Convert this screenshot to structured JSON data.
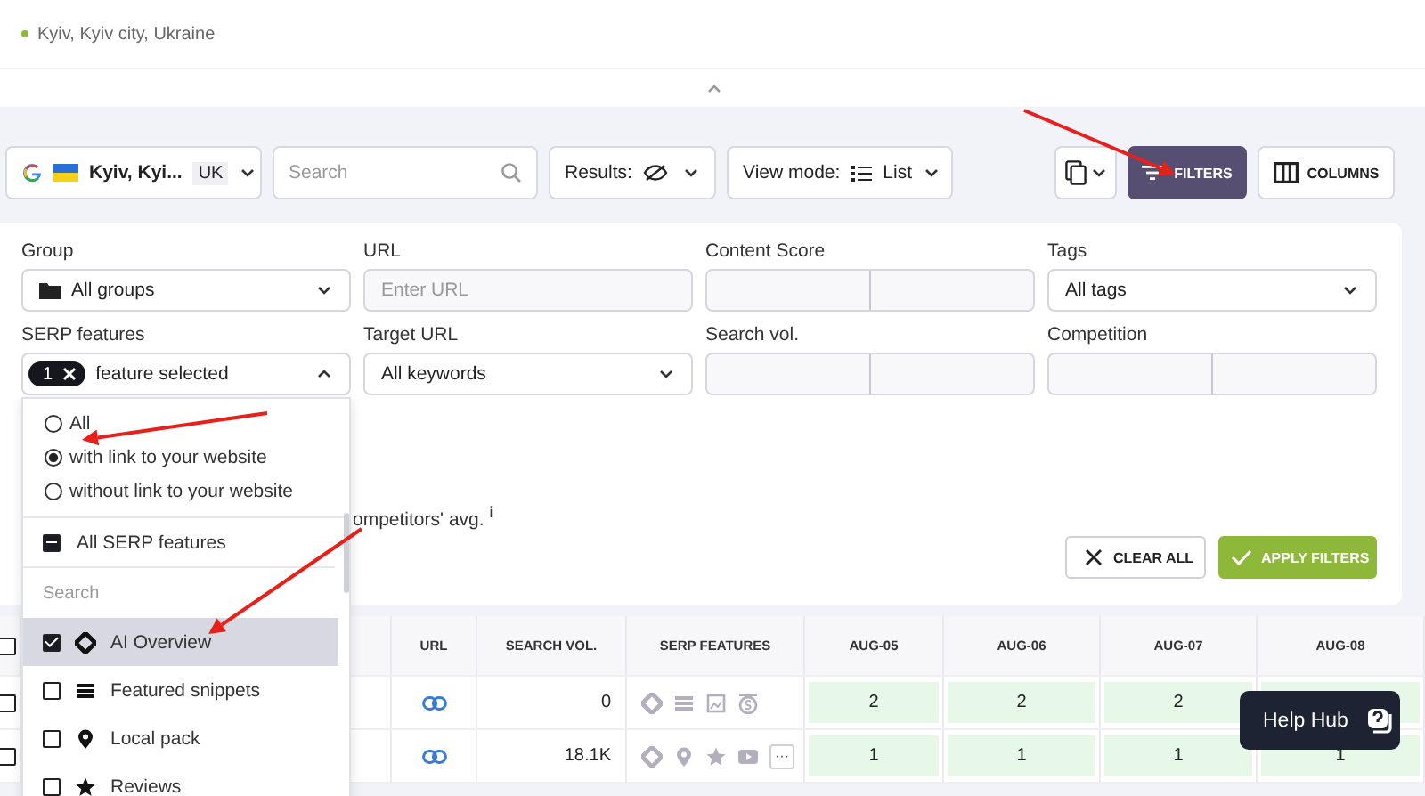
{
  "location": "Kyiv, Kyiv city, Ukraine",
  "toolbar": {
    "engine_location": "Kyiv, Kyi...",
    "language": "UK",
    "search": {
      "placeholder": "Search"
    },
    "results_label": "Results:",
    "view_mode_label": "View mode:",
    "view_mode_value": "List",
    "filters_button": "FILTERS",
    "filters_selected": true,
    "columns_button": "COLUMNS"
  },
  "filters": {
    "fields": [
      {
        "kind": "folder",
        "label": "Group",
        "value": "All groups"
      },
      {
        "kind": "text",
        "label": "URL",
        "placeholder": "Enter URL"
      },
      {
        "kind": "range",
        "label": "Content Score"
      },
      {
        "kind": "select",
        "label": "Tags",
        "value": "All tags"
      },
      {
        "kind": "chips",
        "label": "SERP features",
        "count": "1",
        "value": "feature selected",
        "expanded": true
      },
      {
        "kind": "select",
        "label": "Target URL",
        "value": "All keywords"
      },
      {
        "kind": "range",
        "label": "Search vol."
      },
      {
        "kind": "range",
        "label": "Competition"
      }
    ],
    "partial_text": "ompetitors' avg. $^{i}$",
    "clear_button": "CLEAR ALL",
    "apply_button": "APPLY FILTERS"
  },
  "serp_dropdown": {
    "link_options": [
      {
        "label": "All",
        "selected": false
      },
      {
        "label": "with link to your website",
        "selected": true
      },
      {
        "label": "without link to your website",
        "selected": false
      }
    ],
    "all_features": {
      "label": "All SERP features",
      "partial": true
    },
    "search": {
      "placeholder": "Search"
    },
    "features": [
      {
        "kind": "ai",
        "label": "AI Overview",
        "checked": true,
        "highlighted": true
      },
      {
        "kind": "snippet",
        "label": "Featured snippets",
        "checked": false,
        "highlighted": false
      },
      {
        "kind": "pin",
        "label": "Local pack",
        "checked": false,
        "highlighted": false
      },
      {
        "kind": "star",
        "label": "Reviews",
        "checked": false,
        "highlighted": false
      }
    ]
  },
  "table": {
    "all_checked": false,
    "columns": [
      "URL",
      "SEARCH VOL.",
      "SERP FEATURES",
      "AUG-05",
      "AUG-06",
      "AUG-07",
      "AUG-08"
    ],
    "rows": [
      {
        "checked": false,
        "search_vol": "0",
        "serp_features": [
          {
            "kind": "ai"
          },
          {
            "kind": "snippet"
          },
          {
            "kind": "images"
          },
          {
            "kind": "coin"
          }
        ],
        "positions": [
          "2",
          "2",
          "2"
        ]
      },
      {
        "checked": false,
        "search_vol": "18.1K",
        "serp_features": [
          {
            "kind": "ai"
          },
          {
            "kind": "pin"
          },
          {
            "kind": "star"
          },
          {
            "kind": "video"
          }
        ],
        "more": "···",
        "positions": [
          "1",
          "1",
          "1",
          "1"
        ]
      }
    ]
  },
  "help_hub": "Help Hub",
  "annotations": [
    {
      "kind": "arrow"
    },
    {
      "kind": "arrow"
    },
    {
      "kind": "arrow"
    }
  ]
}
